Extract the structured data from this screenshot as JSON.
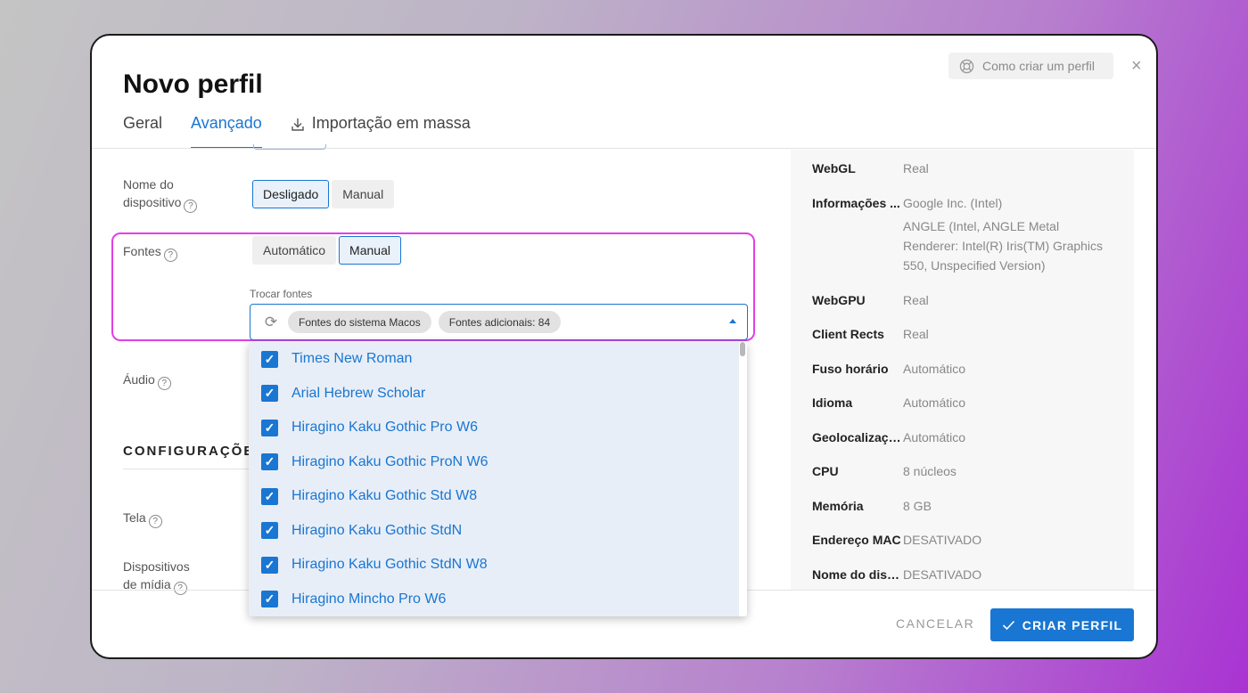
{
  "modal": {
    "title": "Novo perfil",
    "help_label": "Como criar um perfil",
    "close_glyph": "×",
    "tabs": [
      {
        "label": "Geral",
        "active": false
      },
      {
        "label": "Avançado",
        "active": true
      },
      {
        "label": "Importação em massa",
        "active": false,
        "icon": "download-icon"
      }
    ]
  },
  "settings": {
    "device_name": {
      "label_line1": "Nome do",
      "label_line2": "dispositivo",
      "options": [
        "Desligado",
        "Manual"
      ],
      "selected": "Desligado"
    },
    "fonts": {
      "label": "Fontes",
      "options": [
        "Automático",
        "Manual"
      ],
      "selected": "Manual",
      "select_label": "Trocar fontes",
      "chips": [
        "Fontes do sistema Macos",
        "Fontes adicionais: 84"
      ]
    },
    "audio": {
      "label": "Áudio"
    },
    "section_title": "CONFIGURAÇÕES",
    "screen": {
      "label": "Tela"
    },
    "media": {
      "label_line1": "Dispositivos",
      "label_line2": "de mídia"
    }
  },
  "font_list": [
    {
      "name": "Times New Roman",
      "checked": true
    },
    {
      "name": "Arial Hebrew Scholar",
      "checked": true
    },
    {
      "name": "Hiragino Kaku Gothic Pro W6",
      "checked": true
    },
    {
      "name": "Hiragino Kaku Gothic ProN W6",
      "checked": true
    },
    {
      "name": "Hiragino Kaku Gothic Std W8",
      "checked": true
    },
    {
      "name": "Hiragino Kaku Gothic StdN",
      "checked": true
    },
    {
      "name": "Hiragino Kaku Gothic StdN W8",
      "checked": true
    },
    {
      "name": "Hiragino Mincho Pro W6",
      "checked": true
    }
  ],
  "summary": {
    "webgl": {
      "key": "WebGL",
      "value": "Real"
    },
    "info": {
      "key": "Informações ...",
      "value1": "Google Inc. (Intel)",
      "value2": "ANGLE (Intel, ANGLE Metal Renderer: Intel(R) Iris(TM) Graphics 550, Unspecified Version)"
    },
    "webgpu": {
      "key": "WebGPU",
      "value": "Real"
    },
    "client_rects": {
      "key": "Client Rects",
      "value": "Real"
    },
    "timezone": {
      "key": "Fuso horário",
      "value": "Automático"
    },
    "language": {
      "key": "Idioma",
      "value": "Automático"
    },
    "geo": {
      "key": "Geolocalização",
      "value": "Automático"
    },
    "cpu": {
      "key": "CPU",
      "value": "8 núcleos"
    },
    "memory": {
      "key": "Memória",
      "value": "8 GB"
    },
    "mac": {
      "key": "Endereço MAC",
      "value": "DESATIVADO"
    },
    "device": {
      "key": "Nome do disp...",
      "value": "DESATIVADO"
    }
  },
  "footer": {
    "cancel": "CANCELAR",
    "create": "CRIAR PERFIL"
  },
  "colors": {
    "accent": "#1976d2",
    "highlight": "#e040e6"
  }
}
